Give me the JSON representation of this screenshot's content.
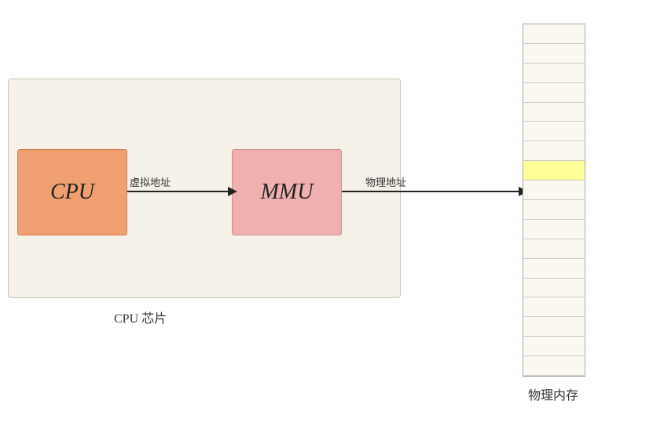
{
  "diagram": {
    "background_color": "#f5f0e8",
    "cpu_chip_label": "CPU 芯片",
    "cpu_label": "CPU",
    "mmu_label": "MMU",
    "virtual_address_label": "虚拟地址",
    "physical_address_label": "物理地址",
    "memory_label": "物理内存",
    "memory_cell_count": 18,
    "highlighted_cell_index": 7,
    "colors": {
      "cpu_bg": "#f0a070",
      "mmu_bg": "#f0b0b0",
      "chip_bg": "#f5f0e8",
      "memory_bg": "#faf8f0",
      "highlighted": "#ffff99",
      "arrow": "#222222",
      "text": "#333333"
    }
  }
}
